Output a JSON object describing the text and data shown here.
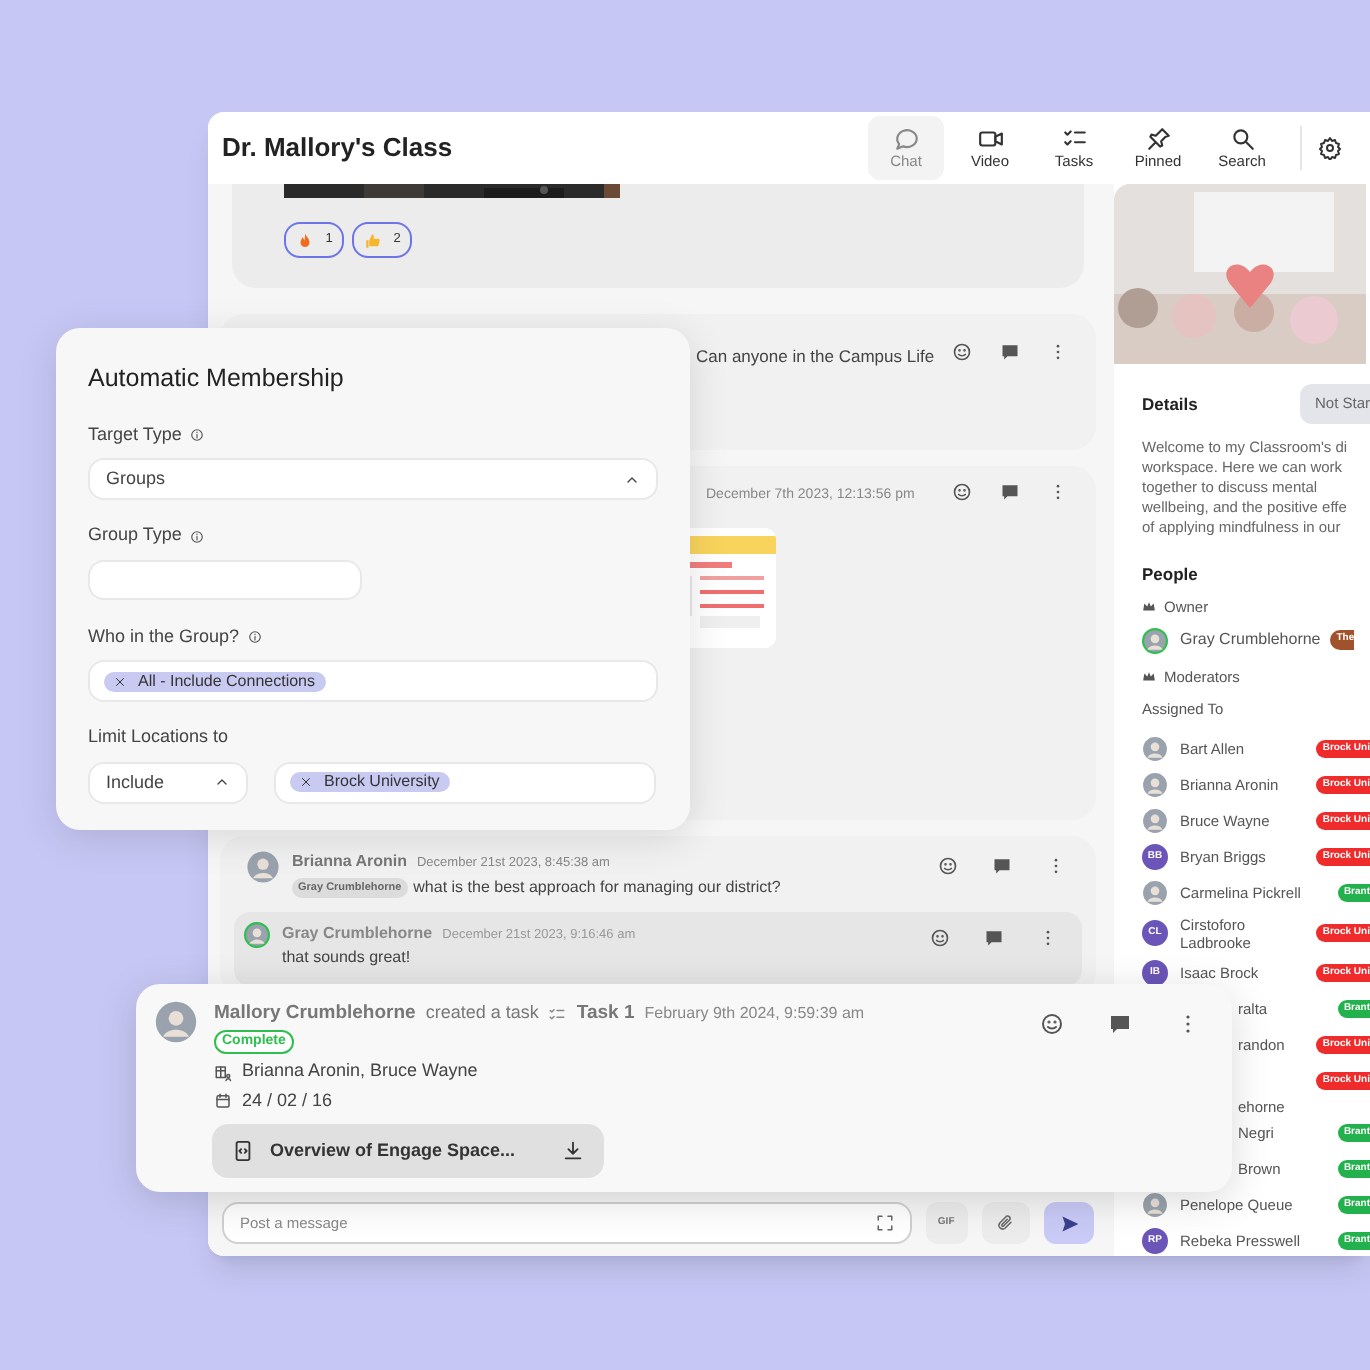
{
  "window": {
    "title": "Dr. Mallory's Class"
  },
  "toolbar": [
    {
      "label": "Chat",
      "selected": true
    },
    {
      "label": "Video",
      "selected": false
    },
    {
      "label": "Tasks",
      "selected": false
    },
    {
      "label": "Pinned",
      "selected": false
    },
    {
      "label": "Search",
      "selected": false
    }
  ],
  "messages": [
    {
      "kind": "media",
      "reactions": [
        {
          "count": "1"
        },
        {
          "count": "2"
        }
      ]
    },
    {
      "kind": "text",
      "text": "Can anyone in the Campus Life"
    },
    {
      "kind": "attachment",
      "time": "December 7th 2023, 12:13:56 pm"
    },
    {
      "kind": "thread",
      "author": "Brianna Aronin",
      "time": "December 21st 2023, 8:45:38 am",
      "mention": "Gray Crumblehorne",
      "text": "what is the best approach for managing our district?",
      "reply": {
        "author": "Gray Crumblehorne",
        "time": "December 21st 2023, 9:16:46 am",
        "text": "that sounds great!"
      }
    }
  ],
  "composer": {
    "placeholder": "Post a message",
    "gif": "GIF"
  },
  "details": {
    "title": "Details",
    "status": "Not Star",
    "description": [
      "Welcome to my Classroom's di",
      "workspace. Here we can work",
      "together to discuss mental",
      "wellbeing, and the positive effe",
      "of applying mindfulness in our"
    ]
  },
  "people": {
    "title": "People",
    "owner_label": "Owner",
    "owner": {
      "name": "Gray Crumblehorne",
      "badge": "The",
      "color": "#a0522d"
    },
    "moderators_label": "Moderators",
    "assigned_label": "Assigned To",
    "assigned": [
      {
        "name": "Bart Allen",
        "badge": "Brock Uni",
        "color": "#ef2b2b"
      },
      {
        "name": "Brianna Aronin",
        "badge": "Brock Uni",
        "color": "#ef2b2b"
      },
      {
        "name": "Bruce Wayne",
        "badge": "Brock Uni",
        "color": "#ef2b2b"
      },
      {
        "name": "Bryan Briggs",
        "kind": "initials",
        "initials": "BB",
        "badge": "Brock Uni",
        "color": "#ef2b2b"
      },
      {
        "name": "Carmelina Pickrell",
        "badge": "Brant",
        "color": "#22b14c"
      },
      {
        "name": "Cirstoforo Ladbrooke",
        "kind": "initials",
        "initials": "CL",
        "badge": "Brock Uni",
        "color": "#ef2b2b"
      },
      {
        "name": "Isaac Brock",
        "kind": "initials",
        "initials": "IB",
        "badge": "Brock Uni",
        "color": "#ef2b2b"
      },
      {
        "name": "ralta",
        "kind": "partial",
        "badge": "Brant",
        "color": "#22b14c"
      },
      {
        "name": "randon",
        "kind": "partial",
        "badge": "Brock Uni",
        "color": "#ef2b2b"
      },
      {
        "name": "ehorne",
        "kind": "partial",
        "badge": "Brock Uni",
        "color": "#ef2b2b"
      },
      {
        "name": "Negri",
        "kind": "partial",
        "badge": "Brant",
        "color": "#22b14c"
      },
      {
        "name": "Brown",
        "kind": "partial",
        "badge": "Brant",
        "color": "#22b14c"
      },
      {
        "name": "Penelope Queue",
        "badge": "Brant",
        "color": "#22b14c"
      },
      {
        "name": "Rebeka Presswell",
        "kind": "initials",
        "initials": "RP",
        "badge": "Brant",
        "color": "#22b14c"
      }
    ]
  },
  "membership_dialog": {
    "title": "Automatic Membership",
    "fields": [
      {
        "kind": "select",
        "label": "Target Type",
        "info": true,
        "value": "Groups"
      },
      {
        "kind": "text",
        "label": "Group Type",
        "info": true
      },
      {
        "kind": "tags",
        "label": "Who in the Group?",
        "info": true,
        "tags": [
          "All - Include Connections"
        ]
      },
      {
        "kind": "location",
        "label": "Limit Locations to",
        "mode": "Include",
        "tags": [
          "Brock University"
        ]
      }
    ]
  },
  "task_card": {
    "author": "Mallory Crumblehorne",
    "action": "created a task",
    "task": "Task 1",
    "time": "February 9th 2024, 9:59:39 am",
    "status": "Complete",
    "assignees": "Brianna Aronin, Bruce Wayne",
    "due": "24 / 02 / 16",
    "file": "Overview of Engage Space..."
  }
}
